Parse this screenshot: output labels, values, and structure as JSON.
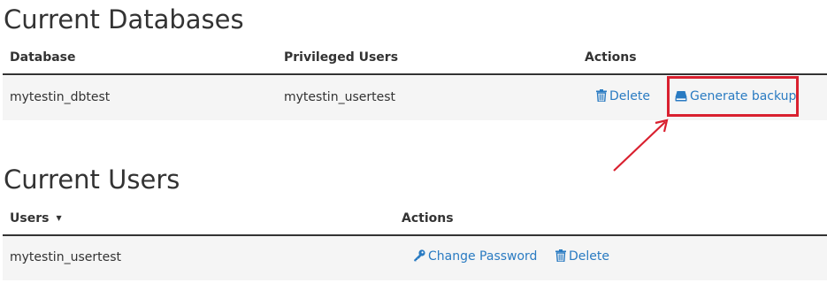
{
  "databases": {
    "title": "Current Databases",
    "columns": [
      "Database",
      "Privileged Users",
      "Actions"
    ],
    "rows": [
      {
        "database": "mytestin_dbtest",
        "user": "mytestin_usertest",
        "delete_label": "Delete",
        "backup_label": "Generate backup"
      }
    ]
  },
  "users": {
    "title": "Current Users",
    "columns": [
      "Users",
      "Actions"
    ],
    "rows": [
      {
        "user": "mytestin_usertest",
        "change_password_label": "Change Password",
        "delete_label": "Delete"
      }
    ]
  },
  "icons": {
    "delete": "trash-icon",
    "backup": "hard-drive-icon",
    "change_password": "key-icon",
    "sort": "sort-caret-down-icon"
  },
  "colors": {
    "link": "#2a7bc2",
    "highlight": "#d9202f",
    "row_background": "#f5f5f5",
    "text": "#333333"
  }
}
